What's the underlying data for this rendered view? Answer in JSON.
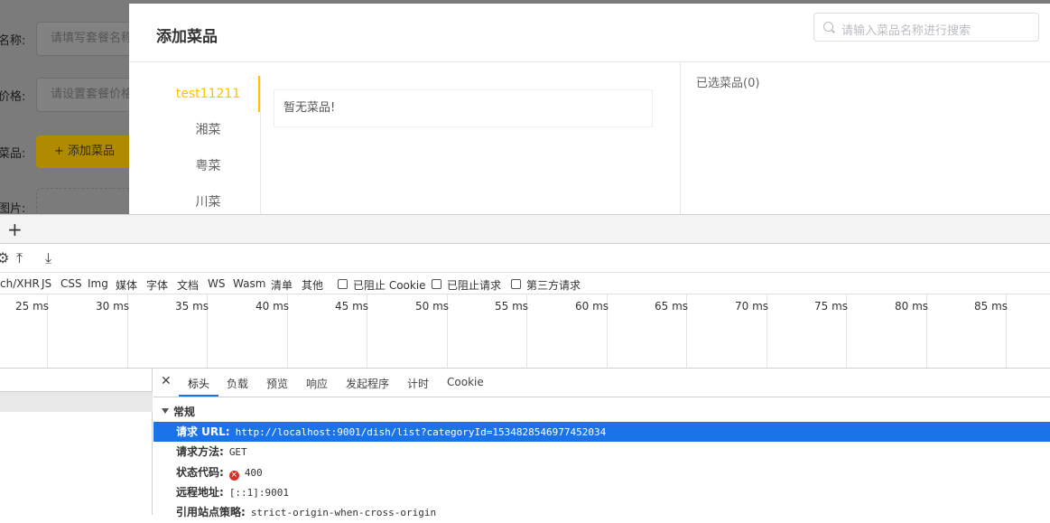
{
  "background_form": {
    "name_label": "名称:",
    "name_placeholder": "请填写套餐名称",
    "price_label": "价格:",
    "price_placeholder": "请设置套餐价格",
    "dish_label": "菜品:",
    "add_dish_button": "+ 添加菜品",
    "image_label": "图片:"
  },
  "dialog": {
    "title": "添加菜品",
    "search_placeholder": "请输入菜品名称进行搜索",
    "categories": [
      "test11211",
      "湘菜",
      "粤菜",
      "川菜"
    ],
    "active_category": "test11211",
    "empty_text": "暂无菜品!",
    "selected_title": "已选菜品(0)"
  },
  "devtools": {
    "filters": [
      "ch/XHR",
      "JS",
      "CSS",
      "Img",
      "媒体",
      "字体",
      "文档",
      "WS",
      "Wasm",
      "清单",
      "其他"
    ],
    "checkboxes": [
      "已阻止 Cookie",
      "已阻止请求",
      "第三方请求"
    ],
    "timeline_ticks": [
      "25 ms",
      "30 ms",
      "35 ms",
      "40 ms",
      "45 ms",
      "50 ms",
      "55 ms",
      "60 ms",
      "65 ms",
      "70 ms",
      "75 ms",
      "80 ms",
      "85 ms"
    ],
    "detail_tabs": [
      "标头",
      "负载",
      "预览",
      "响应",
      "发起程序",
      "计时",
      "Cookie"
    ],
    "active_tab": "标头",
    "section_title": "常规",
    "general": [
      {
        "key": "请求 URL:",
        "value": "http://localhost:9001/dish/list?categoryId=1534828546977452034"
      },
      {
        "key": "请求方法:",
        "value": "GET"
      },
      {
        "key": "状态代码:",
        "value": "400"
      },
      {
        "key": "远程地址:",
        "value": "[::1]:9001"
      },
      {
        "key": "引用站点策略:",
        "value": "strict-origin-when-cross-origin"
      }
    ],
    "accent_color": "#1a73e8",
    "error_color": "#d93025"
  },
  "brand_color": "#ffc200"
}
